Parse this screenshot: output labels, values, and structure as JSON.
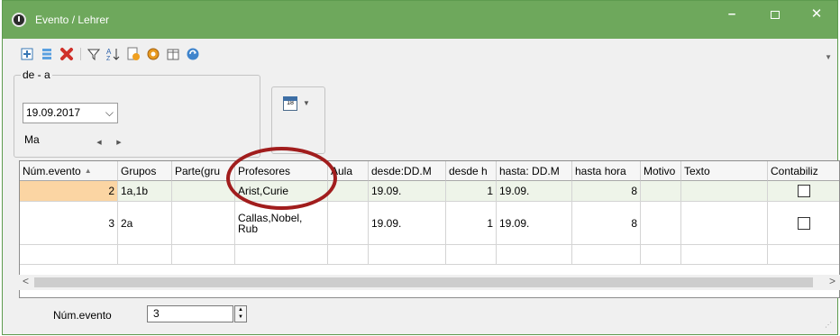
{
  "window": {
    "title": "Evento / Lehrer",
    "titlebar_color": "#6ea85c",
    "controls": {
      "minimize": "–",
      "close": "✕"
    }
  },
  "toolbar": {
    "icons": [
      "add-row-icon",
      "list-icon",
      "delete-icon",
      "filter-icon",
      "sort-icon",
      "report-icon",
      "settings-gear-icon",
      "calendar-view-icon",
      "refresh-icon"
    ]
  },
  "filter": {
    "group_label": "de - a",
    "date_value": "19.09.2017",
    "weekday": "Ma"
  },
  "grid": {
    "columns": [
      "Núm.evento",
      "Grupos",
      "Parte(gru",
      "Profesores",
      "Aula",
      "desde:DD.M",
      "desde h",
      "hasta: DD.M",
      "hasta hora",
      "Motivo",
      "Texto",
      "Contabiliz"
    ],
    "rows": [
      {
        "num": "2",
        "grupos": "1a,1b",
        "parte": "",
        "profesores": "Arist,Curie",
        "aula": "",
        "desde": "19.09.",
        "desde_h": "1",
        "hasta": "19.09.",
        "hasta_h": "8",
        "motivo": "",
        "texto": ""
      },
      {
        "num": "3",
        "grupos": "2a",
        "parte": "",
        "profesores": "Callas,Nobel, Rub",
        "aula": "",
        "desde": "19.09.",
        "desde_h": "1",
        "hasta": "19.09.",
        "hasta_h": "8",
        "motivo": "",
        "texto": ""
      }
    ],
    "selected_row_color": "#fbd5a3",
    "highlight_color": "#a11d1d"
  },
  "footer": {
    "label": "Núm.evento",
    "value": "3"
  }
}
